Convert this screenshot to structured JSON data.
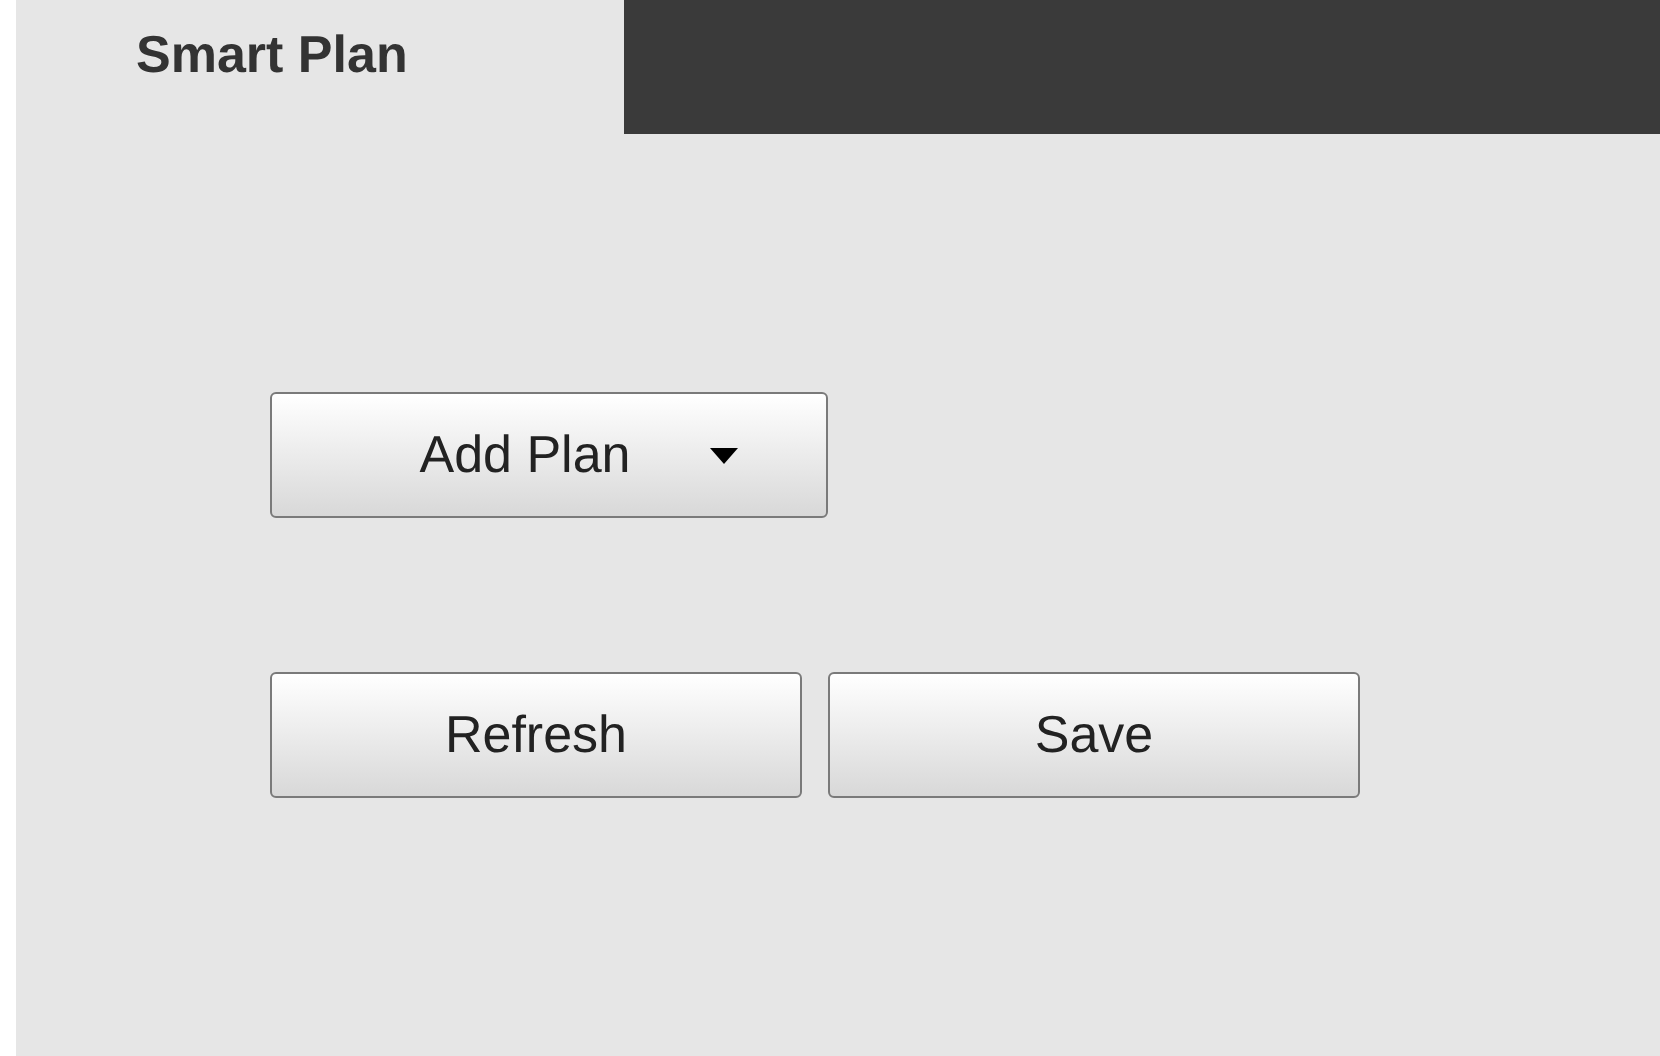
{
  "tabs": [
    {
      "label": "Smart Plan",
      "selected": true
    }
  ],
  "add_plan_menu": {
    "label": "Add Plan"
  },
  "buttons": [
    "Refresh",
    "Save"
  ]
}
